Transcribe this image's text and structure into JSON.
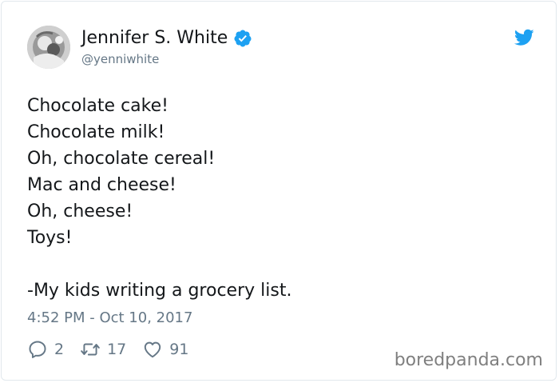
{
  "user": {
    "display_name": "Jennifer S. White",
    "handle": "@yenniwhite",
    "verified": true,
    "avatar": "profile-photo"
  },
  "tweet": {
    "lines": [
      "Chocolate cake!",
      "Chocolate milk!",
      "Oh, chocolate cereal!",
      "Mac and cheese!",
      "Oh, cheese!",
      "Toys!",
      "",
      "-My kids writing a grocery list."
    ],
    "timestamp": "4:52 PM - Oct 10, 2017"
  },
  "actions": {
    "replies": "2",
    "retweets": "17",
    "likes": "91"
  },
  "icons": {
    "brand": "twitter-bird-icon",
    "verified": "verified-badge-icon",
    "reply": "reply-icon",
    "retweet": "retweet-icon",
    "like": "heart-icon"
  },
  "colors": {
    "twitter_blue": "#1da1f2",
    "secondary_text": "#657786",
    "primary_text": "#14171a",
    "watermark": "#7f7f7f"
  },
  "watermark": "boredpanda.com"
}
